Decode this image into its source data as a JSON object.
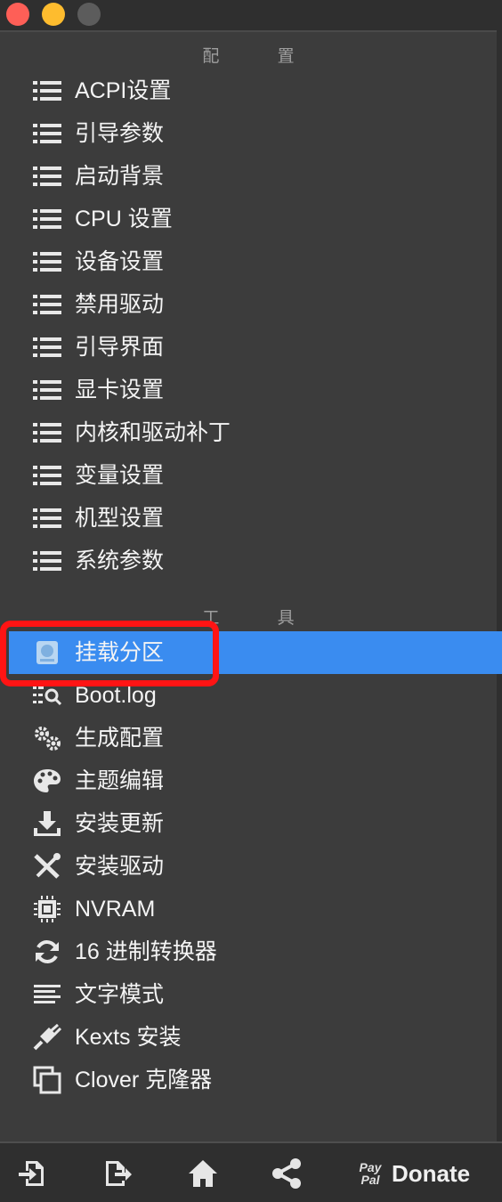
{
  "window": {
    "controls": [
      "close",
      "minimize",
      "zoom"
    ]
  },
  "config_section": {
    "title": "配 置",
    "items": [
      {
        "label": "ACPI设置",
        "icon": "list-icon"
      },
      {
        "label": "引导参数",
        "icon": "list-icon"
      },
      {
        "label": "启动背景",
        "icon": "list-icon"
      },
      {
        "label": "CPU 设置",
        "icon": "list-icon"
      },
      {
        "label": "设备设置",
        "icon": "list-icon"
      },
      {
        "label": "禁用驱动",
        "icon": "list-icon"
      },
      {
        "label": "引导界面",
        "icon": "list-icon"
      },
      {
        "label": "显卡设置",
        "icon": "list-icon"
      },
      {
        "label": "内核和驱动补丁",
        "icon": "list-icon"
      },
      {
        "label": "变量设置",
        "icon": "list-icon"
      },
      {
        "label": "机型设置",
        "icon": "list-icon"
      },
      {
        "label": "系统参数",
        "icon": "list-icon"
      }
    ]
  },
  "tools_section": {
    "title": "工 具",
    "items": [
      {
        "label": "挂载分区",
        "icon": "disk-icon",
        "selected": true
      },
      {
        "label": "Boot.log",
        "icon": "log-search-icon"
      },
      {
        "label": "生成配置",
        "icon": "gears-icon"
      },
      {
        "label": "主题编辑",
        "icon": "palette-icon"
      },
      {
        "label": "安装更新",
        "icon": "download-icon"
      },
      {
        "label": "安装驱动",
        "icon": "tools-icon"
      },
      {
        "label": "NVRAM",
        "icon": "chip-icon"
      },
      {
        "label": "16 进制转换器",
        "icon": "refresh-icon"
      },
      {
        "label": "文字模式",
        "icon": "text-lines-icon"
      },
      {
        "label": "Kexts 安装",
        "icon": "plug-icon"
      },
      {
        "label": "Clover 克隆器",
        "icon": "clone-icon"
      }
    ]
  },
  "toolbar": {
    "buttons": [
      "import-icon",
      "export-icon",
      "home-icon",
      "share-icon"
    ],
    "paypal_line1": "Pay",
    "paypal_line2": "Pal",
    "donate_label": "Donate"
  },
  "colors": {
    "background": "#3c3c3c",
    "selection": "#3a8cf0",
    "highlight": "#ff1414"
  }
}
